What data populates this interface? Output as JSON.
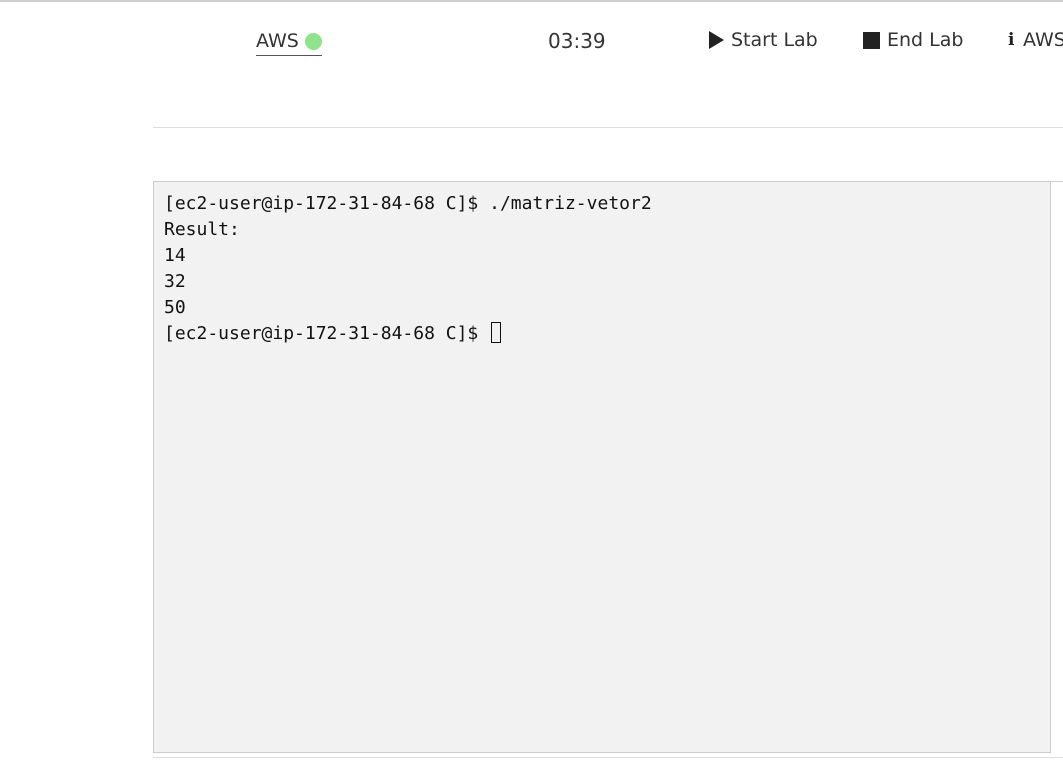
{
  "toolbar": {
    "aws_label": "AWS",
    "aws_status_color": "#8ee38b",
    "timer": "03:39",
    "start_label": "Start Lab",
    "end_label": "End Lab",
    "aws_details_label": "AWS"
  },
  "terminal": {
    "lines": [
      "[ec2-user@ip-172-31-84-68 C]$ ./matriz-vetor2",
      "Result:",
      "14",
      "32",
      "50"
    ],
    "prompt": "[ec2-user@ip-172-31-84-68 C]$ "
  }
}
